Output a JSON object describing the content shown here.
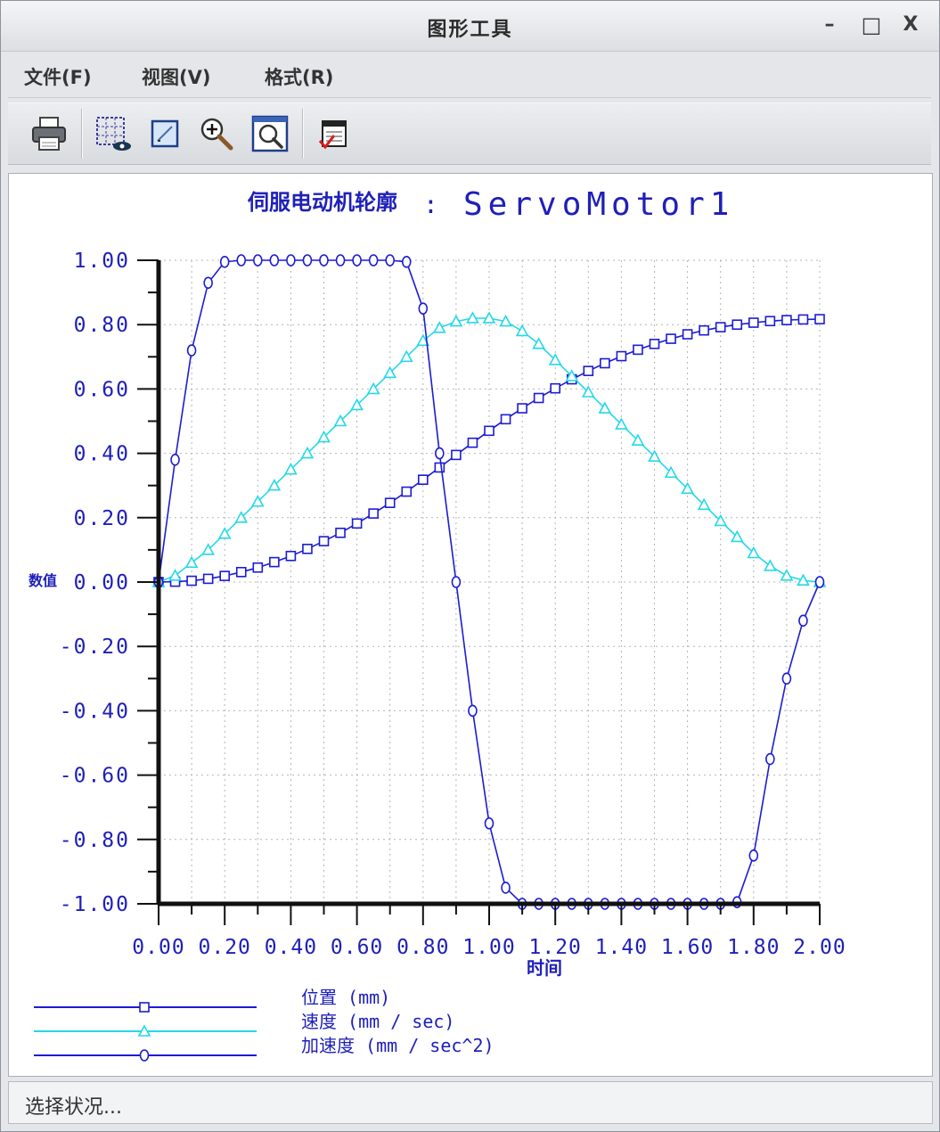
{
  "window": {
    "title": "图形工具",
    "minimize": "–",
    "maximize": "□",
    "close": "X"
  },
  "menu": [
    {
      "label": "文件(F)"
    },
    {
      "label": "视图(V)"
    },
    {
      "label": "格式(R)"
    }
  ],
  "toolbar": [
    {
      "icon": "printer-icon"
    },
    {
      "icon": "grid-view-icon"
    },
    {
      "icon": "edit-format-icon"
    },
    {
      "icon": "zoom-in-icon"
    },
    {
      "icon": "zoom-fit-icon"
    },
    {
      "icon": "export-table-icon"
    }
  ],
  "status": {
    "text": "选择状况..."
  },
  "chart_data": {
    "type": "line",
    "title_prefix": "伺服电动机轮廓",
    "title_sep": ":",
    "title_name": "ServoMotor1",
    "xlabel": "时间",
    "ylabel": "数值",
    "xlim": [
      0,
      2
    ],
    "ylim": [
      -1,
      1
    ],
    "grid": true,
    "legend_position": "bottom-left",
    "xticks": [
      "0.00",
      "0.20",
      "0.40",
      "0.60",
      "0.80",
      "1.00",
      "1.20",
      "1.40",
      "1.60",
      "1.80",
      "2.00"
    ],
    "yticks": [
      "1.00",
      "0.80",
      "0.60",
      "0.40",
      "0.20",
      "0.00",
      "-0.20",
      "-0.40",
      "-0.60",
      "-0.80",
      "-1.00"
    ],
    "x": [
      0,
      0.05,
      0.1,
      0.15,
      0.2,
      0.25,
      0.3,
      0.35,
      0.4,
      0.45,
      0.5,
      0.55,
      0.6,
      0.65,
      0.7,
      0.75,
      0.8,
      0.85,
      0.9,
      0.95,
      1.0,
      1.05,
      1.1,
      1.15,
      1.2,
      1.25,
      1.3,
      1.35,
      1.4,
      1.45,
      1.5,
      1.55,
      1.6,
      1.65,
      1.7,
      1.75,
      1.8,
      1.85,
      1.9,
      1.95,
      2.0
    ],
    "series": [
      {
        "name": "位置 (mm)",
        "color": "#1c1cd4",
        "marker": "square",
        "values": [
          0,
          0.001,
          0.004,
          0.01,
          0.019,
          0.031,
          0.045,
          0.062,
          0.081,
          0.103,
          0.127,
          0.153,
          0.182,
          0.213,
          0.246,
          0.281,
          0.318,
          0.356,
          0.395,
          0.433,
          0.47,
          0.506,
          0.54,
          0.572,
          0.602,
          0.63,
          0.656,
          0.68,
          0.702,
          0.722,
          0.74,
          0.756,
          0.77,
          0.782,
          0.792,
          0.8,
          0.806,
          0.811,
          0.814,
          0.816,
          0.817
        ]
      },
      {
        "name": "速度 (mm / sec)",
        "color": "#24d8e8",
        "marker": "triangle",
        "values": [
          0,
          0.02,
          0.06,
          0.1,
          0.15,
          0.2,
          0.25,
          0.3,
          0.35,
          0.4,
          0.45,
          0.5,
          0.55,
          0.6,
          0.65,
          0.7,
          0.75,
          0.79,
          0.81,
          0.82,
          0.82,
          0.81,
          0.78,
          0.74,
          0.69,
          0.64,
          0.59,
          0.54,
          0.49,
          0.44,
          0.39,
          0.34,
          0.29,
          0.24,
          0.19,
          0.14,
          0.09,
          0.05,
          0.02,
          0.005,
          0
        ]
      },
      {
        "name": "加速度 (mm / sec^2)",
        "color": "#1c1cd4",
        "marker": "circle",
        "values": [
          0,
          0.38,
          0.72,
          0.93,
          0.995,
          1,
          1,
          1,
          1,
          1,
          1,
          1,
          1,
          1,
          1,
          0.995,
          0.85,
          0.4,
          0,
          -0.4,
          -0.75,
          -0.95,
          -1,
          -1,
          -1,
          -1,
          -1,
          -1,
          -1,
          -1,
          -1,
          -1,
          -1,
          -1,
          -1,
          -0.995,
          -0.85,
          -0.55,
          -0.3,
          -0.12,
          0
        ]
      }
    ]
  }
}
